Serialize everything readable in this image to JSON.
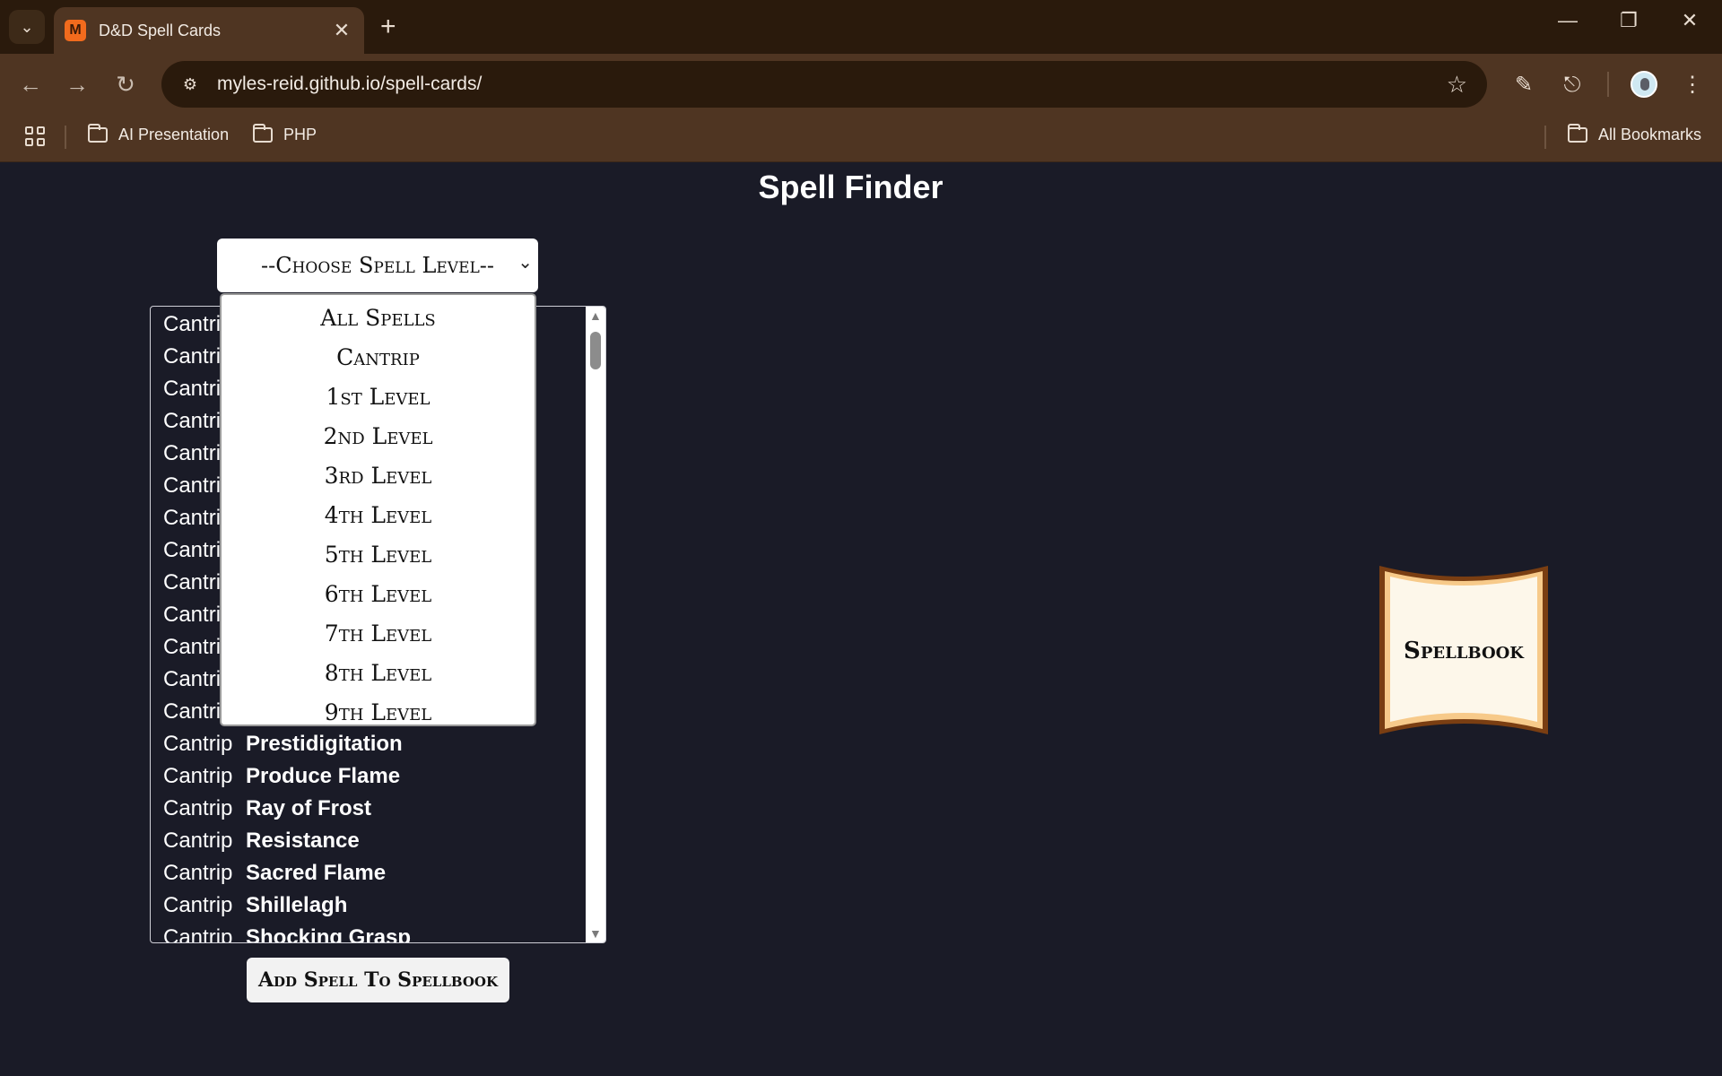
{
  "browser": {
    "tab_title": "D&D Spell Cards",
    "favicon_letter": "M",
    "url": "myles-reid.github.io/spell-cards/",
    "bookmarks": [
      "AI Presentation",
      "PHP"
    ],
    "all_bookmarks": "All Bookmarks"
  },
  "page": {
    "title": "Spell Finder",
    "level_select_value": "--Choose Spell Level--",
    "dropdown_options": [
      "All Spells",
      "Cantrip",
      "1st Level",
      "2nd Level",
      "3rd Level",
      "4th Level",
      "5th Level",
      "6th Level",
      "7th Level",
      "8th Level",
      "9th Level"
    ],
    "spells": [
      {
        "level": "Cantrip",
        "name": ""
      },
      {
        "level": "Cantrip",
        "name": ""
      },
      {
        "level": "Cantrip",
        "name": ""
      },
      {
        "level": "Cantrip",
        "name": ""
      },
      {
        "level": "Cantrip",
        "name": ""
      },
      {
        "level": "Cantrip",
        "name": ""
      },
      {
        "level": "Cantrip",
        "name": ""
      },
      {
        "level": "Cantrip",
        "name": ""
      },
      {
        "level": "Cantrip",
        "name": ""
      },
      {
        "level": "Cantrip",
        "name": ""
      },
      {
        "level": "Cantrip",
        "name": ""
      },
      {
        "level": "Cantrip",
        "name": ""
      },
      {
        "level": "Cantrip",
        "name": ""
      },
      {
        "level": "Cantrip",
        "name": "Prestidigitation"
      },
      {
        "level": "Cantrip",
        "name": "Produce Flame"
      },
      {
        "level": "Cantrip",
        "name": "Ray of Frost"
      },
      {
        "level": "Cantrip",
        "name": "Resistance"
      },
      {
        "level": "Cantrip",
        "name": "Sacred Flame"
      },
      {
        "level": "Cantrip",
        "name": "Shillelagh"
      },
      {
        "level": "Cantrip",
        "name": "Shocking Grasp"
      }
    ],
    "add_button": "Add Spell To Spellbook",
    "spellbook_label": "Spellbook"
  }
}
